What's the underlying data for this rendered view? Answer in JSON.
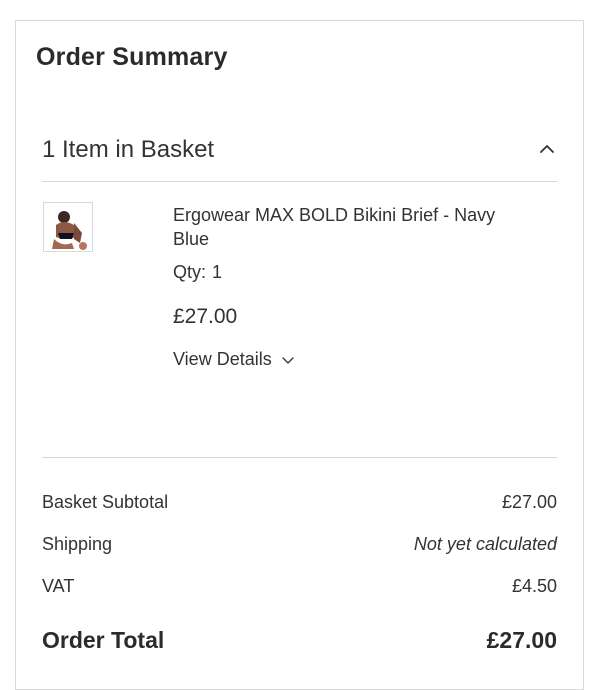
{
  "summary": {
    "title": "Order Summary",
    "items_count_label": "1 Item in Basket",
    "collapse_icon": "chevron-up-icon"
  },
  "item": {
    "name": "Ergowear MAX BOLD Bikini Brief - Navy Blue",
    "qty_label": "Qty:",
    "qty_value": "1",
    "price": "£27.00",
    "view_details_label": "View Details",
    "view_details_icon": "chevron-down-icon"
  },
  "totals": {
    "subtotal_label": "Basket Subtotal",
    "subtotal_value": "£27.00",
    "shipping_label": "Shipping",
    "shipping_value": "Not yet calculated",
    "vat_label": "VAT",
    "vat_value": "£4.50",
    "total_label": "Order Total",
    "total_value": "£27.00"
  }
}
